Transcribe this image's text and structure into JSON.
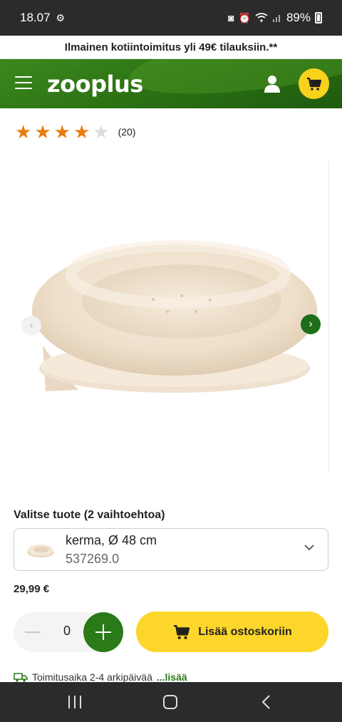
{
  "status": {
    "time": "18.07",
    "battery": "89%",
    "icons": [
      "settings-gear-icon",
      "data-saver-icon",
      "alarm-icon",
      "wifi-icon",
      "signal-icon",
      "battery-icon"
    ]
  },
  "promo": {
    "text": "Ilmainen kotiintoimitus yli 49€ tilauksiin.**"
  },
  "header": {
    "logo": "zooplus",
    "icons": [
      "menu-icon",
      "user-icon",
      "cart-icon"
    ]
  },
  "rating": {
    "value": 4,
    "max": 5,
    "count": "(20)"
  },
  "gallery": {
    "image": "cream plush round cat bed on wooden wall-mounted platform",
    "prev_icon": "chevron-left-icon",
    "next_icon": "chevron-right-icon"
  },
  "variant": {
    "label": "Valitse tuote (2 vaihtoehtoa)",
    "name": "kerma, Ø 48 cm",
    "sku": "537269.0",
    "chevron": "chevron-down-icon"
  },
  "price": "29,99 €",
  "quantity": {
    "value": "0"
  },
  "add_to_cart": {
    "label": "Lisää ostoskoriin"
  },
  "delivery": {
    "text": "Toimitusaika 2-4 arkipäivää",
    "more": " ...lisää"
  },
  "colors": {
    "brand_green": "#2a7a17",
    "accent_yellow": "#fcd62a",
    "star_orange": "#e97c10"
  }
}
